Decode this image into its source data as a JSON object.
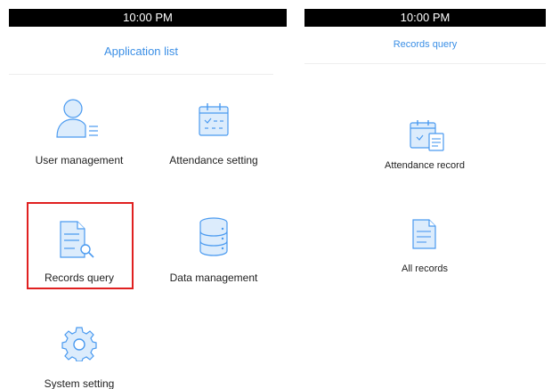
{
  "left_screen": {
    "status_time": "10:00 PM",
    "title": "Application list",
    "apps": [
      {
        "label": "User management",
        "icon": "user-icon"
      },
      {
        "label": "Attendance setting",
        "icon": "calendar-icon"
      },
      {
        "label": "Records query",
        "icon": "document-search-icon"
      },
      {
        "label": "Data management",
        "icon": "database-icon"
      },
      {
        "label": "System setting",
        "icon": "gear-icon"
      }
    ],
    "highlighted_app": "Records query"
  },
  "right_screen": {
    "status_time": "10:00 PM",
    "title": "Records query",
    "items": [
      {
        "label": "Attendance record",
        "icon": "calendar-document-icon"
      },
      {
        "label": "All records",
        "icon": "document-icon"
      }
    ]
  },
  "colors": {
    "accent": "#3b8fe6",
    "icon_fill": "#dcecfc",
    "icon_stroke": "#4a9af0",
    "highlight": "#e02020",
    "status_bar": "#000000"
  }
}
